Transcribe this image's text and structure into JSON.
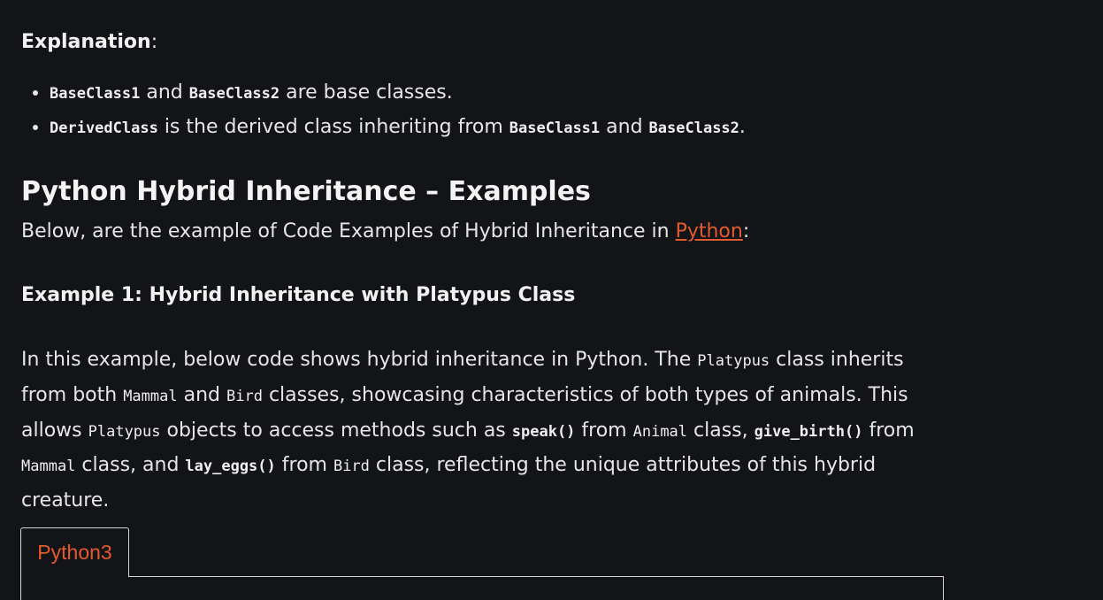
{
  "explanation": {
    "label": "Explanation",
    "colon": ":"
  },
  "bullets": [
    {
      "c1": "BaseClass1",
      "t1": " and ",
      "c2": "BaseClass2",
      "t2": " are base classes."
    },
    {
      "c1": "DerivedClass",
      "t1": " is the derived class inheriting from ",
      "c2": "BaseClass1",
      "t2": " and ",
      "c3": "BaseClass2",
      "t3": "."
    }
  ],
  "section": {
    "title": "Python Hybrid Inheritance – Examples",
    "intro_before": "Below, are the example of Code Examples of Hybrid Inheritance in ",
    "intro_link": "Python",
    "intro_after": ":"
  },
  "example": {
    "title": "Example 1: Hybrid Inheritance with Platypus Class",
    "p1": "In this example, below code shows hybrid inheritance in Python. The ",
    "code_platypus": "Platypus",
    "p2": " class inherits from both ",
    "code_mammal": "Mammal",
    "p3": " and ",
    "code_bird": "Bird",
    "p4": " classes, showcasing characteristics of both types of animals. This allows ",
    "code_platypus2": "Platypus",
    "p5": " objects to access methods such as ",
    "code_speak": "speak()",
    "p6": " from ",
    "code_animal": "Animal",
    "p7": " class, ",
    "code_give_birth": "give_birth()",
    "p8": " from ",
    "code_mammal2": "Mammal",
    "p9": " class, and ",
    "code_lay_eggs": "lay_eggs()",
    "p10": " from ",
    "code_bird2": "Bird",
    "p11": " class, reflecting the unique attributes of this hybrid creature."
  },
  "code_tab": {
    "label": "Python3"
  },
  "colors": {
    "background": "#131417",
    "text": "#e6e6e6",
    "link": "#e35a2f",
    "border": "#d6d6d6"
  }
}
